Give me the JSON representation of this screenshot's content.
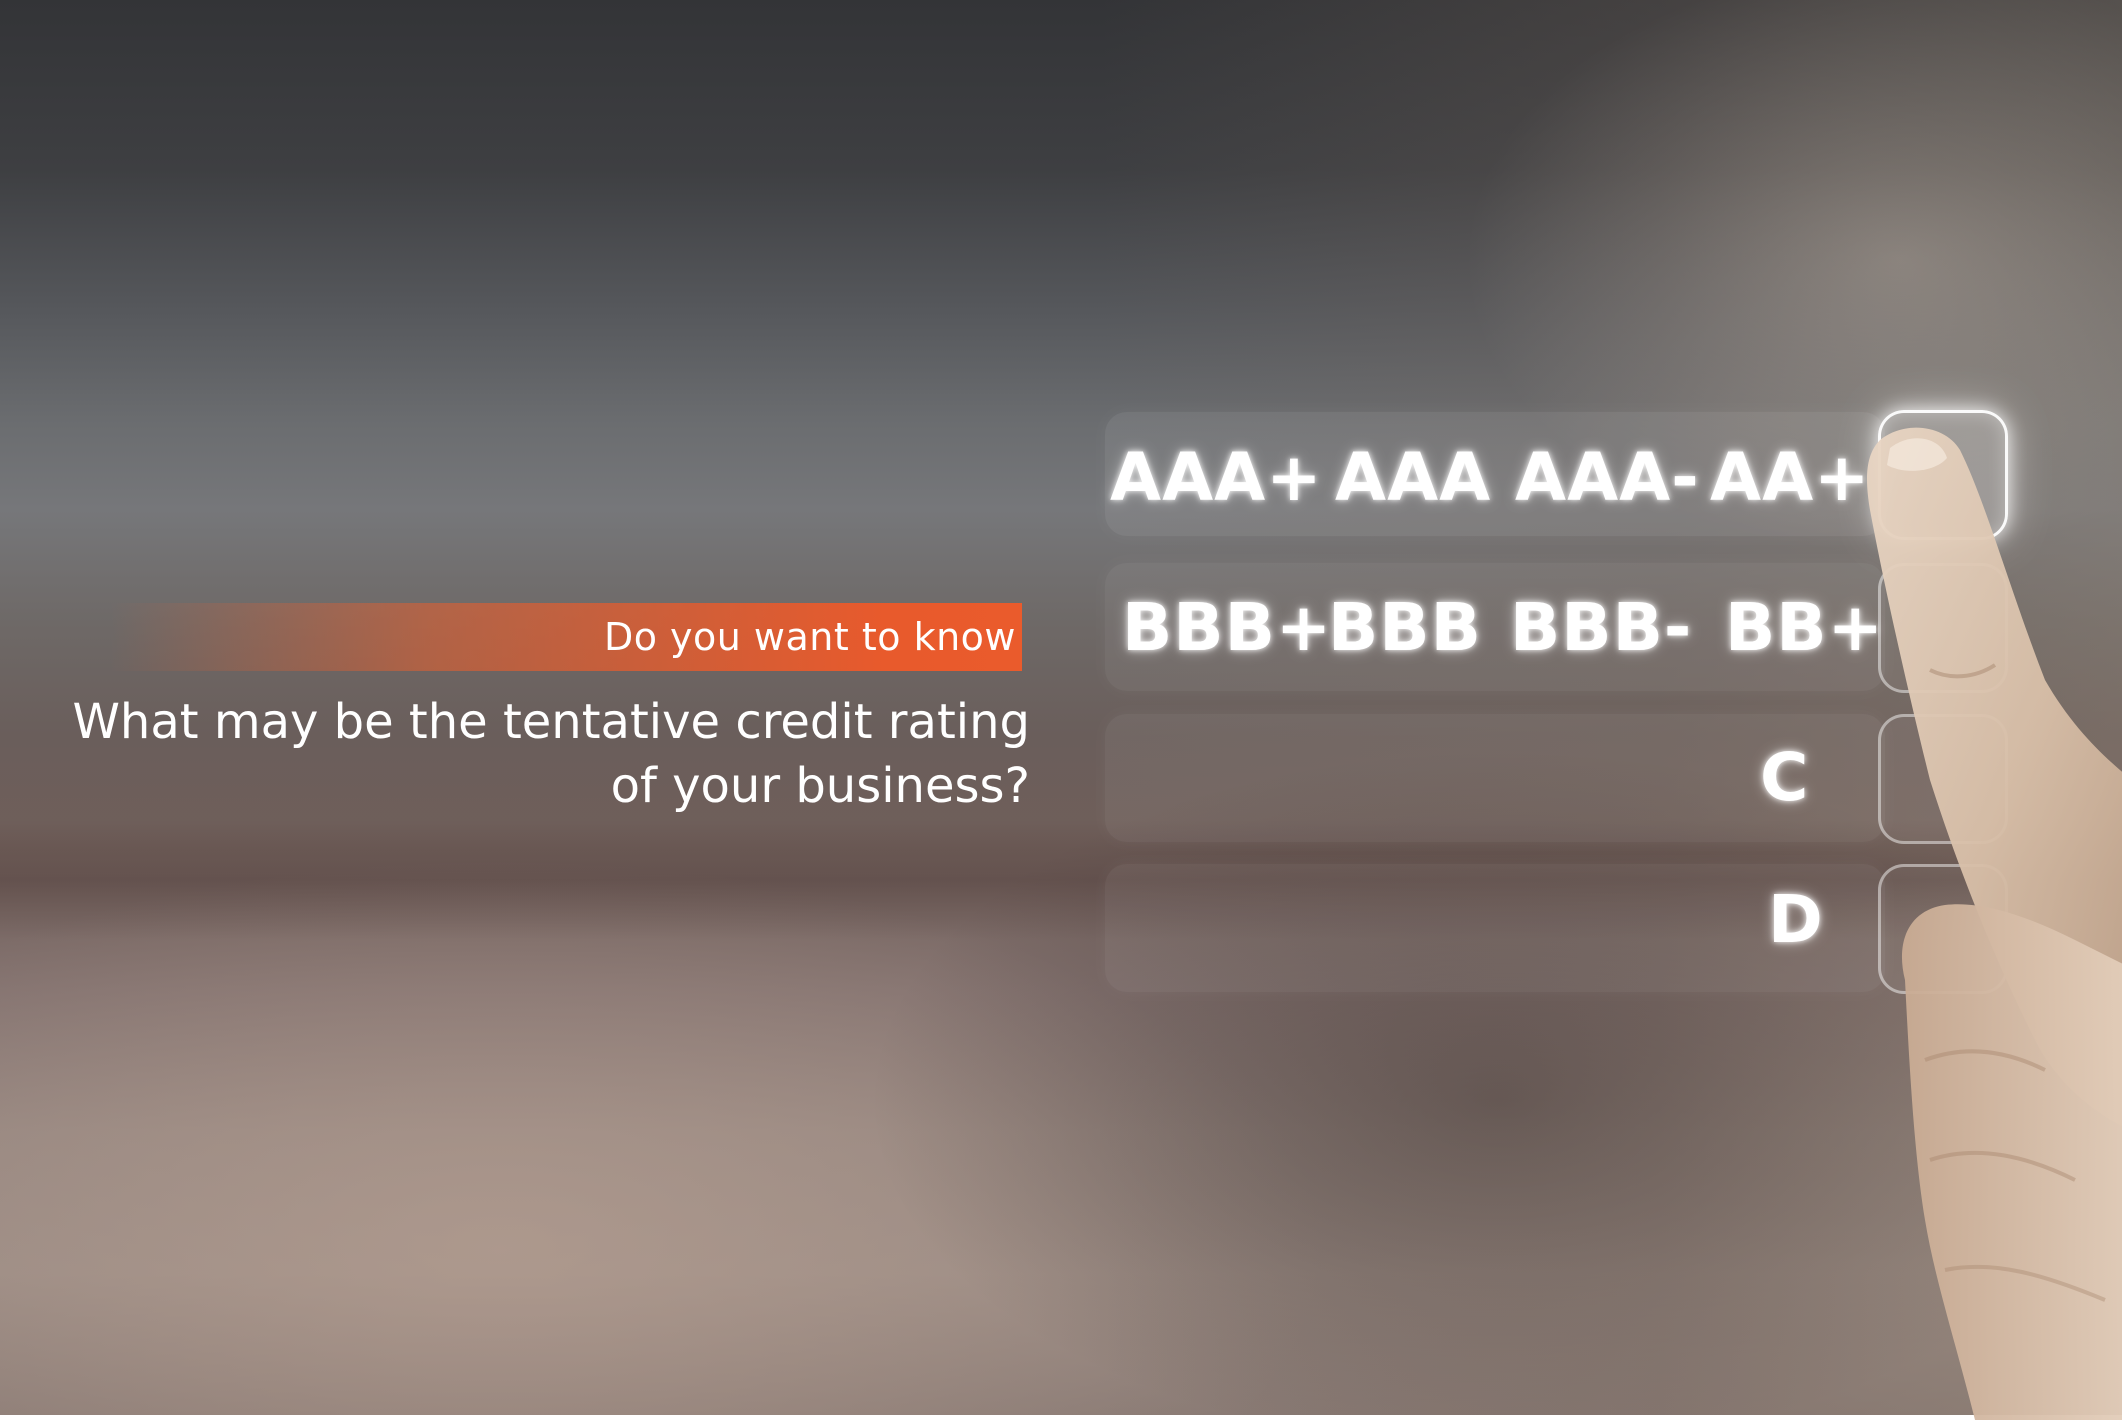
{
  "banner": {
    "text": "Do you want to know"
  },
  "question": {
    "line1": "What may be the tentative credit rating",
    "line2": "of your business?"
  },
  "ratings": {
    "row1": [
      "AAA+",
      "AAA",
      "AAA-",
      "AA+"
    ],
    "row2": [
      "BBB+",
      "BBB",
      "BBB-",
      "BB+"
    ],
    "row3": [
      "C"
    ],
    "row4": [
      "D"
    ]
  },
  "selected_row": 1,
  "colors": {
    "accent": "#e85a2c",
    "text": "#ffffff"
  }
}
